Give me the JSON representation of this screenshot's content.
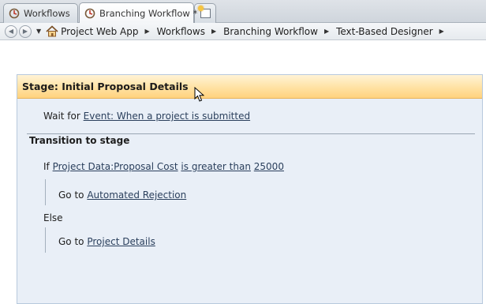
{
  "tabs": [
    {
      "label": "Workflows",
      "icon": "workflow-icon",
      "active": false
    },
    {
      "label": "Branching Workflow *",
      "icon": "workflow-icon",
      "active": true,
      "close": "×"
    }
  ],
  "new_tab": {
    "icon": "new-tab-icon"
  },
  "breadcrumb": {
    "back_icon": "back-arrow-icon",
    "forward_icon": "forward-arrow-icon",
    "items": [
      "Project Web App",
      "Workflows",
      "Branching Workflow",
      "Text-Based Designer"
    ]
  },
  "stage": {
    "title": "Stage: Initial Proposal Details",
    "wait_prefix": "Wait for",
    "wait_event": "Event: When a project is submitted",
    "transition_heading": "Transition to stage",
    "if_keyword": "If",
    "condition_field": "Project Data:Proposal Cost",
    "condition_operator": "is greater than",
    "condition_value": "25000",
    "goto_prefix": "Go to",
    "if_target": "Automated Rejection",
    "else_keyword": "Else",
    "else_target": "Project Details"
  },
  "colors": {
    "header_gradient_top": "#fff3d6",
    "header_gradient_bottom": "#ffd27e",
    "stage_background": "#e9eff7",
    "link_color": "#2a3f5c"
  }
}
